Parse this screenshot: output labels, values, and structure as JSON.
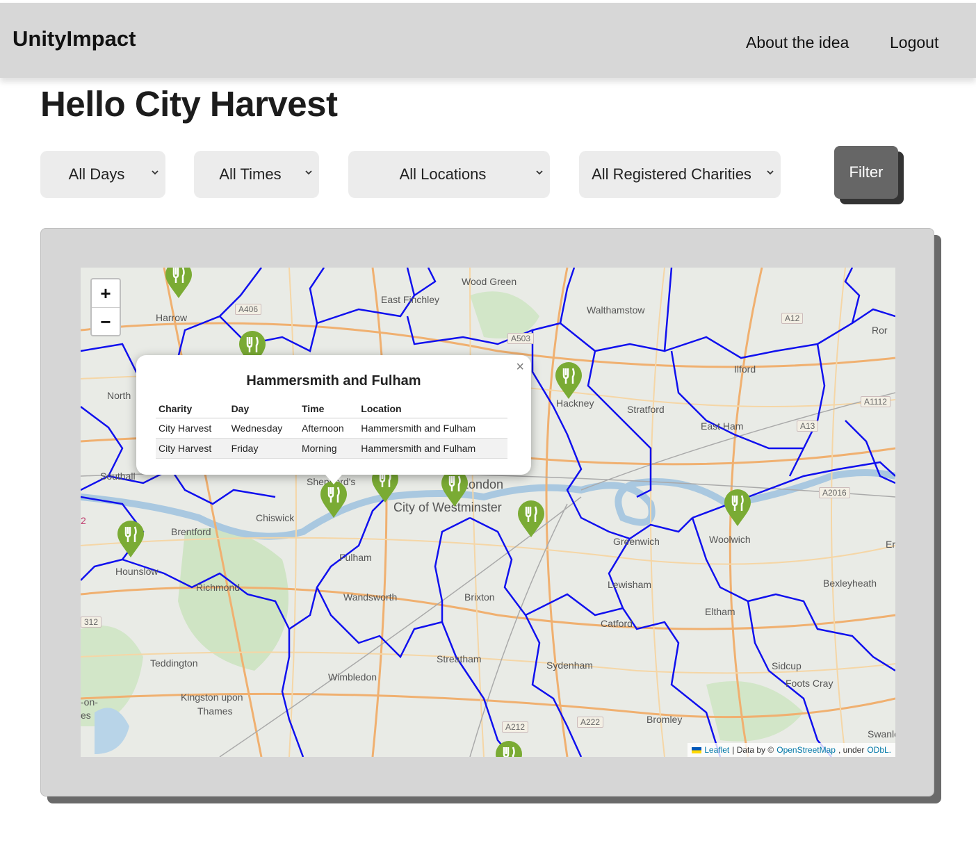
{
  "nav": {
    "brand": "UnityImpact",
    "about": "About the idea",
    "logout": "Logout"
  },
  "page": {
    "title": "Hello City Harvest"
  },
  "filters": {
    "days": "All Days",
    "times": "All Times",
    "locations": "All Locations",
    "charities": "All Registered Charities",
    "button": "Filter"
  },
  "map": {
    "zoom_in": "+",
    "zoom_out": "−",
    "places": [
      "Wood Green",
      "East Finchley",
      "Walthamstow",
      "Harrow",
      "North",
      "Hackney",
      "Stratford",
      "Ilford",
      "East Ham",
      "Southall",
      "Shepherd's",
      "London",
      "City of Westminster",
      "Chiswick",
      "Brentford",
      "Woolwich",
      "Hounslow",
      "Fulham",
      "Greenwich",
      "Richmond",
      "Wandsworth",
      "Brixton",
      "Lewisham",
      "Bexleyheath",
      "Eltham",
      "Catford",
      "Teddington",
      "Streatham",
      "Sydenham",
      "Sidcup",
      "Wimbledon",
      "Foots Cray",
      "Kingston upon",
      "Thames",
      "Bromley",
      "Swanley",
      "-on-",
      "es"
    ],
    "roads": [
      "A406",
      "A12",
      "A503",
      "A1112",
      "A13",
      "A2016",
      "A212",
      "A222",
      "312",
      "Er",
      "Ror",
      "2"
    ],
    "marker_icon": "fork-knife-icon",
    "marker_color": "#7aab34",
    "boundary_color": "#1010ee",
    "attribution": {
      "leaflet": "Leaflet",
      "sep": "| Data by ©",
      "osm": "OpenStreetMap",
      "under": ", under",
      "odbl": "ODbL."
    }
  },
  "popup": {
    "close": "×",
    "title": "Hammersmith and Fulham",
    "headers": [
      "Charity",
      "Day",
      "Time",
      "Location"
    ],
    "rows": [
      [
        "City Harvest",
        "Wednesday",
        "Afternoon",
        "Hammersmith and Fulham"
      ],
      [
        "City Harvest",
        "Friday",
        "Morning",
        "Hammersmith and Fulham"
      ]
    ]
  }
}
